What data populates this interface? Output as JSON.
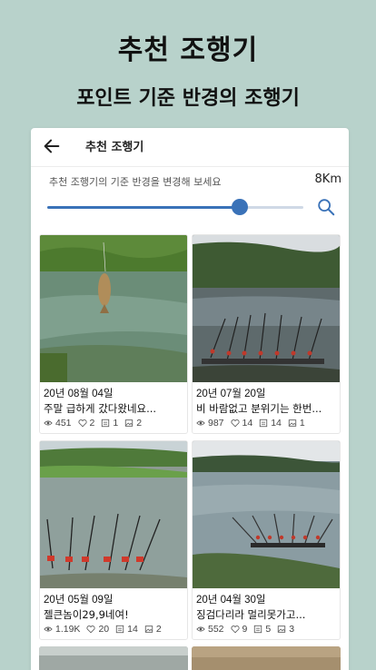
{
  "promo": {
    "title": "추천 조행기",
    "subtitle": "포인트 기준 반경의 조행기"
  },
  "appbar": {
    "title": "추천 조행기"
  },
  "radius": {
    "label": "추천 조행기의 기준 반경을 변경해 보세요",
    "value": "8Km",
    "slider_fraction": 0.75
  },
  "cards": [
    {
      "date": "20년 08월 04일",
      "caption": "주말 급하게 갔다왔네요...",
      "views": "451",
      "likes": "2",
      "comments": "1",
      "photos": "2"
    },
    {
      "date": "20년 07월 20일",
      "caption": "비 바람없고 분위기는 한번...",
      "views": "987",
      "likes": "14",
      "comments": "14",
      "photos": "1"
    },
    {
      "date": "20년 05월 09일",
      "caption": "젤큰놈이29,9네여!",
      "views": "1.19K",
      "likes": "20",
      "comments": "14",
      "photos": "2"
    },
    {
      "date": "20년 04월 30일",
      "caption": "징검다리라 멀리못가고...",
      "views": "552",
      "likes": "9",
      "comments": "5",
      "photos": "3"
    }
  ],
  "colors": {
    "background": "#b8d2cb",
    "accent": "#3a72b8"
  }
}
